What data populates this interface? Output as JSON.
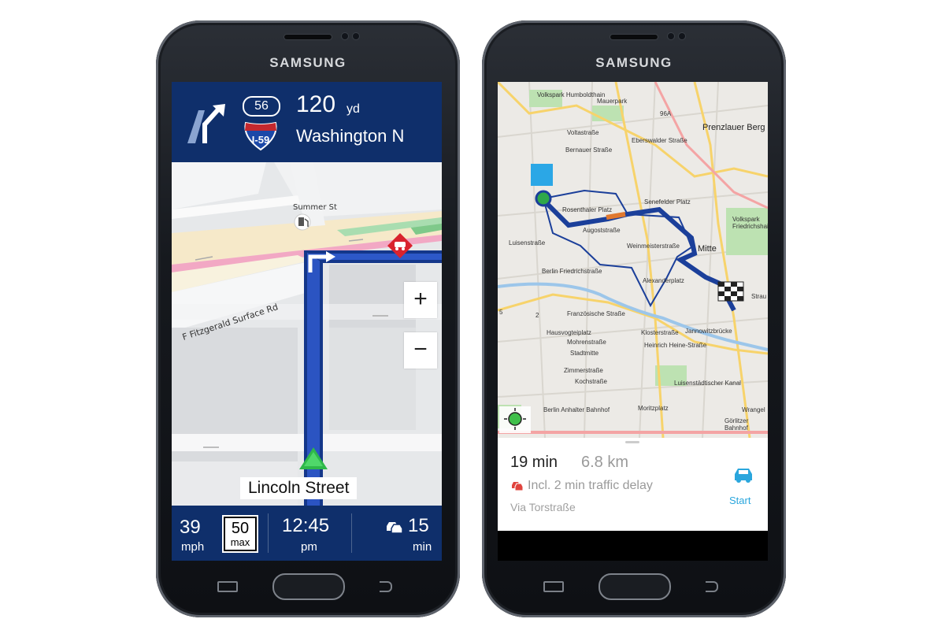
{
  "phones": [
    {
      "brand": "SAMSUNG",
      "app": "navigation",
      "maneuver": {
        "icon": "turn-slight-left-icon"
      },
      "route_shields": [
        {
          "label": "56",
          "style": "state-route-oval"
        },
        {
          "label": "I-59",
          "style": "interstate-shield"
        }
      ],
      "distance": {
        "value": "120",
        "unit": "yd"
      },
      "next_street": "Washington N",
      "map": {
        "street_labels": [
          "Summer St",
          "F Fitzgerald Surface Rd"
        ],
        "current_street": "Lincoln Street",
        "icons": [
          "gas-station-icon",
          "traffic-incident-icon",
          "position-arrow-icon"
        ],
        "zoom_in": "+",
        "zoom_out": "−"
      },
      "stats": {
        "speed": {
          "value": "39",
          "unit": "mph"
        },
        "limit": {
          "value": "50",
          "unit": "max"
        },
        "clock": {
          "value": "12:45",
          "unit": "pm"
        },
        "remaining": {
          "icon": "traffic-car-icon",
          "value": "15",
          "unit": "min"
        }
      }
    },
    {
      "brand": "SAMSUNG",
      "app": "route-overview",
      "map": {
        "labels": [
          "Volkspark Humboldthain",
          "Mauerpark",
          "96A",
          "Voltastraße",
          "Bernauer Straße",
          "Eberswalder Straße",
          "Prenzlauer Berg",
          "Senefelder Platz",
          "Rosenthaler Platz",
          "Augoststraße",
          "Weinmeisterstraße",
          "Mitte",
          "Berlin Friedrichstraße",
          "Alexanderplatz",
          "Luisenstraße",
          "Französische Straße",
          "Hausvogteiplatz",
          "Klosterstraße",
          "Jannowitzbrücke",
          "Mohrenstraße",
          "Stadtmitte",
          "Heinrich Heine-Straße",
          "Zimmerstraße",
          "Kochstraße",
          "Luisenstädtischer Kanal",
          "Berlin Anhalter Bahnhof",
          "Moritzplatz",
          "Görlitzer Bahnhof",
          "Volkspark Friedrichshain",
          "Strau",
          "Wrangel",
          "2",
          "5"
        ]
      },
      "route": {
        "time": "19 min",
        "distance": "6.8 km",
        "delay_text": "Incl. 2 min traffic delay",
        "via": "Via Torstraße",
        "start_label": "Start",
        "start_icon": "car-icon"
      }
    }
  ]
}
